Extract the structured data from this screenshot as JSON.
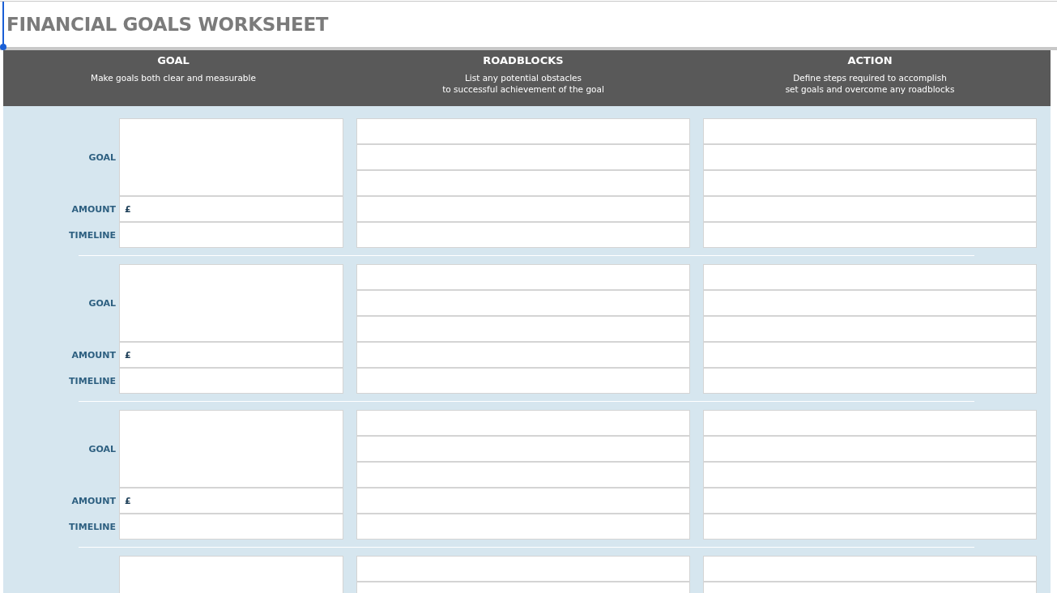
{
  "title": "FINANCIAL GOALS WORKSHEET",
  "columns": [
    {
      "heading": "GOAL",
      "description": "Make goals both clear and measurable"
    },
    {
      "heading": "ROADBLOCKS",
      "description": "List any potential obstacles\nto successful achievement of the goal"
    },
    {
      "heading": "ACTION",
      "description": "Define steps required to accomplish\nset goals and overcome any roadblocks"
    }
  ],
  "blocks": [
    {
      "labels": {
        "goal": "GOAL",
        "amount": "AMOUNT",
        "timeline": "TIMELINE"
      },
      "currency": "£"
    },
    {
      "labels": {
        "goal": "GOAL",
        "amount": "AMOUNT",
        "timeline": "TIMELINE"
      },
      "currency": "£"
    },
    {
      "labels": {
        "goal": "GOAL",
        "amount": "AMOUNT",
        "timeline": "TIMELINE"
      },
      "currency": "£"
    }
  ],
  "more_blocks_below": true
}
